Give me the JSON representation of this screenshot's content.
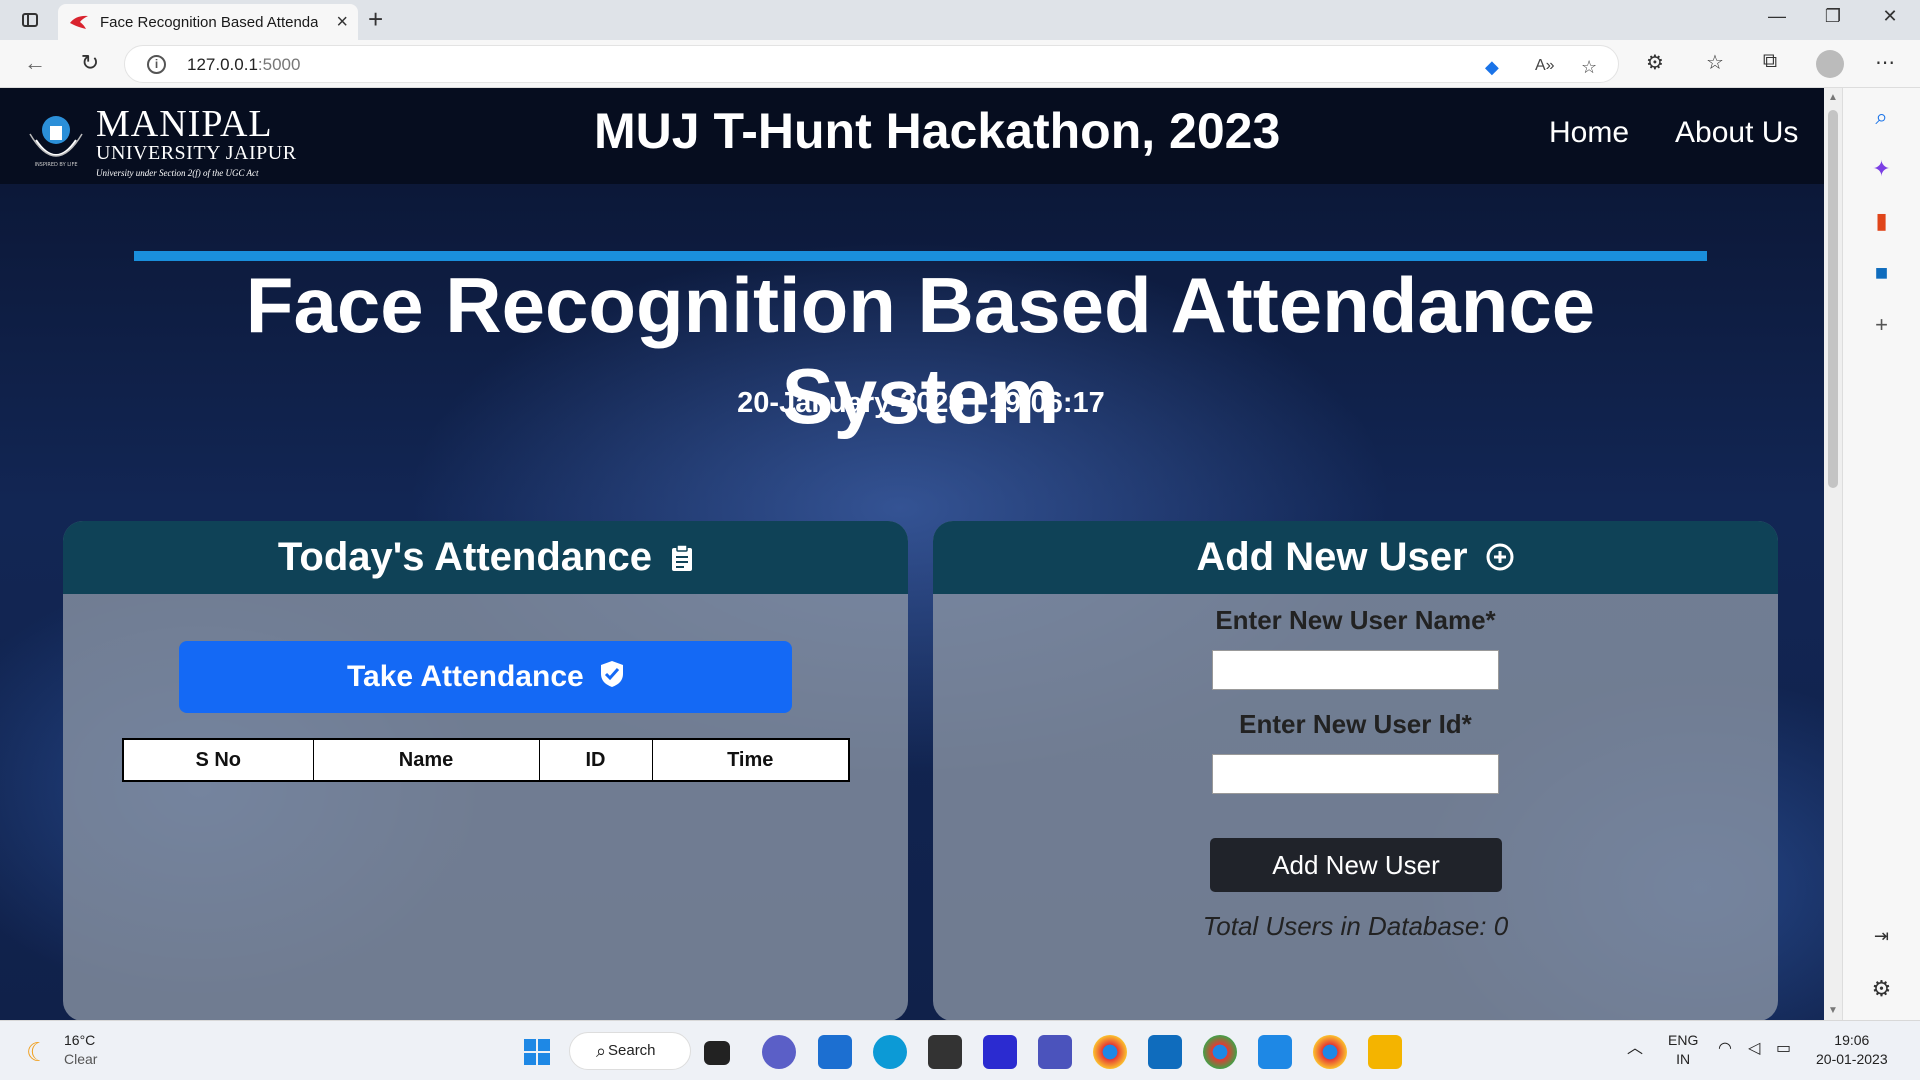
{
  "browser": {
    "tab_title": "Face Recognition Based Attendan",
    "url_host": "127.0.0.1",
    "url_port": ":5000"
  },
  "site": {
    "logo_line1": "MANIPAL",
    "logo_line2": "UNIVERSITY JAIPUR",
    "logo_line3": "University under Section 2(f) of the UGC Act",
    "logo_tagline": "INSPIRED BY LIFE",
    "event_title": "MUJ T-Hunt Hackathon, 2023",
    "nav": [
      "Home",
      "About Us"
    ],
    "heading": "Face Recognition Based Attendance System",
    "datetime": "20-January-2023 | 19:06:17"
  },
  "attendance_panel": {
    "title": "Today's Attendance",
    "button": "Take Attendance",
    "columns": [
      "S No",
      "Name",
      "ID",
      "Time"
    ]
  },
  "add_user_panel": {
    "title": "Add New User",
    "name_label": "Enter New User Name*",
    "id_label": "Enter New User Id*",
    "button": "Add New User",
    "total_users": "Total Users in Database: 0"
  },
  "taskbar": {
    "temp": "16°C",
    "condition": "Clear",
    "search": "Search",
    "lang1": "ENG",
    "lang2": "IN",
    "time": "19:06",
    "date": "20-01-2023"
  },
  "colors": {
    "accent_rule": "#1a8fdc",
    "panel_head": "#0f4257",
    "take_btn": "#1469f5",
    "add_btn": "#20232a"
  }
}
